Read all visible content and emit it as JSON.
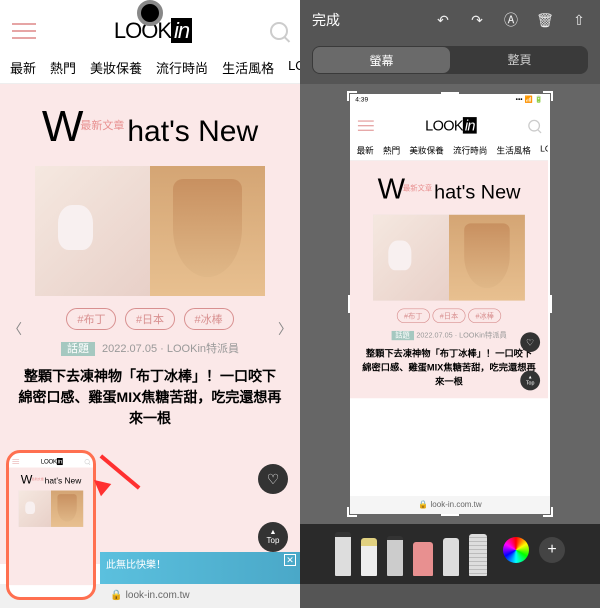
{
  "logo_text": "LOOK",
  "logo_suffix": "in",
  "nav": [
    "最新",
    "熱門",
    "美妝保養",
    "流行時尚",
    "生活風格",
    "LO"
  ],
  "whats_new_sub": "最新文章",
  "whats_new": "hat's New",
  "tags": [
    "#布丁",
    "#日本",
    "#冰棒"
  ],
  "meta_cat": "話題",
  "meta_date": "2022.07.05",
  "meta_author": "LOOKin特派員",
  "article": "整顆下去凍神物「布丁冰棒」！一口咬下綿密口感、雞蛋MIX焦糖苦甜，吃完還想再來一根",
  "top_label": "Top",
  "url": "look-in.com.tw",
  "ad_text": "此無比快樂！",
  "ios": {
    "done": "完成",
    "seg_screen": "螢幕",
    "seg_full": "整頁",
    "time": "4:39",
    "signal": "📶"
  }
}
